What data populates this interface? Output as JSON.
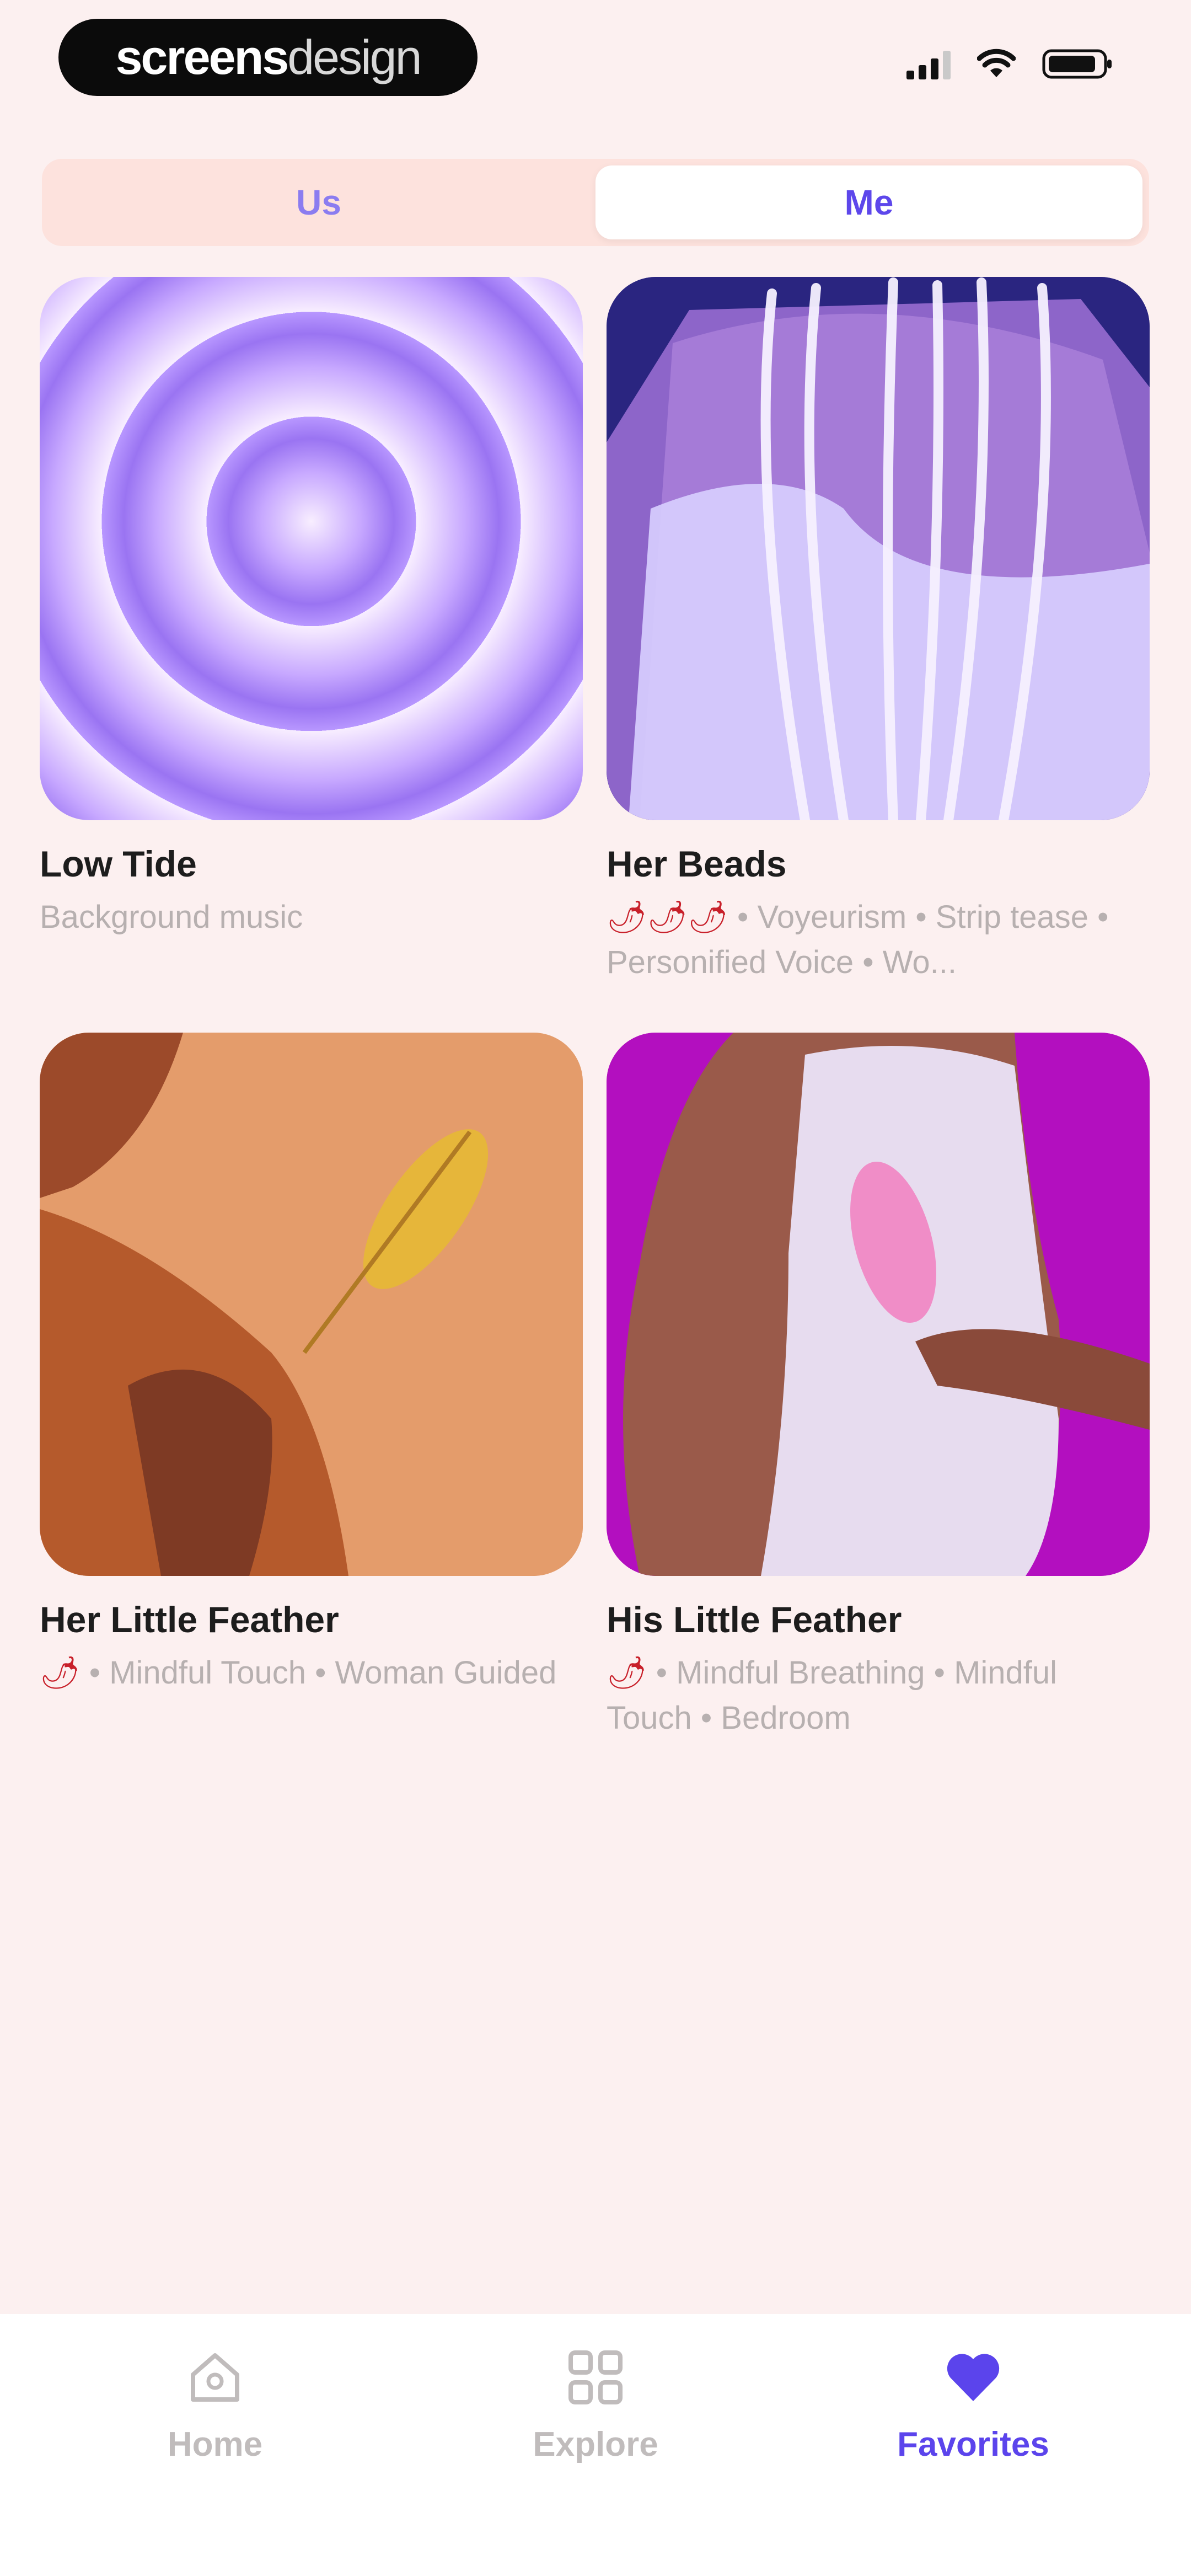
{
  "status_bar": {
    "logo_text_bold": "screens",
    "logo_text_light": "design",
    "signal_icon": "signal-icon",
    "wifi_icon": "wifi-icon",
    "battery_icon": "battery-icon"
  },
  "segment": {
    "options": [
      {
        "label": "Us",
        "selected": false
      },
      {
        "label": "Me",
        "selected": true
      }
    ]
  },
  "cards": [
    {
      "title": "Low Tide",
      "chili": "",
      "meta": "Background music"
    },
    {
      "title": "Her Beads",
      "chili": "🌶🌶🌶",
      "meta": " • Voyeurism • Strip tease • Personified Voice • Wo..."
    },
    {
      "title": "Her Little Feather",
      "chili": "🌶",
      "meta": " • Mindful Touch • Woman Guided"
    },
    {
      "title": "His Little Feather",
      "chili": "🌶",
      "meta": " • Mindful Breathing • Mindful Touch • Bedroom"
    }
  ],
  "bottom_nav": {
    "items": [
      {
        "label": "Home",
        "icon": "home-icon",
        "active": false
      },
      {
        "label": "Explore",
        "icon": "grid-icon",
        "active": false
      },
      {
        "label": "Favorites",
        "icon": "heart-icon",
        "active": true
      }
    ]
  },
  "colors": {
    "accent": "#5b44ec",
    "background": "#fcf0f0",
    "segment_bg": "#fde2dd",
    "chili": "#c8202a"
  }
}
